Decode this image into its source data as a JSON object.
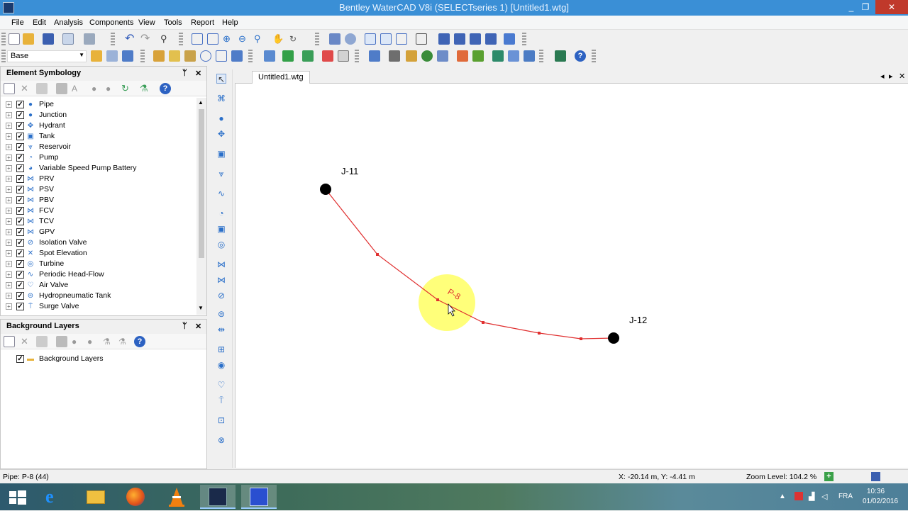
{
  "window": {
    "title": "Bentley WaterCAD V8i (SELECTseries 1) [Untitled1.wtg]",
    "minimize": "_",
    "restore": "❐",
    "close": "✕"
  },
  "menu": {
    "items": [
      "File",
      "Edit",
      "Analysis",
      "Components",
      "View",
      "Tools",
      "Report",
      "Help"
    ]
  },
  "toolbar": {
    "scenario": "Base"
  },
  "element_symbology": {
    "title": "Element Symbology",
    "pin": "ᛘ",
    "close": "✕",
    "items": [
      {
        "label": "Pipe",
        "icon": "pipe-icon",
        "glyph": "●"
      },
      {
        "label": "Junction",
        "icon": "junction-icon",
        "glyph": "●"
      },
      {
        "label": "Hydrant",
        "icon": "hydrant-icon",
        "glyph": "✥"
      },
      {
        "label": "Tank",
        "icon": "tank-icon",
        "glyph": "▣"
      },
      {
        "label": "Reservoir",
        "icon": "reservoir-icon",
        "glyph": "⩔"
      },
      {
        "label": "Pump",
        "icon": "pump-icon",
        "glyph": "◔"
      },
      {
        "label": "Variable Speed Pump Battery",
        "icon": "vspb-icon",
        "glyph": "◕"
      },
      {
        "label": "PRV",
        "icon": "prv-icon",
        "glyph": "⋈"
      },
      {
        "label": "PSV",
        "icon": "psv-icon",
        "glyph": "⋈"
      },
      {
        "label": "PBV",
        "icon": "pbv-icon",
        "glyph": "⋈"
      },
      {
        "label": "FCV",
        "icon": "fcv-icon",
        "glyph": "⋈"
      },
      {
        "label": "TCV",
        "icon": "tcv-icon",
        "glyph": "⋈"
      },
      {
        "label": "GPV",
        "icon": "gpv-icon",
        "glyph": "⋈"
      },
      {
        "label": "Isolation Valve",
        "icon": "isolation-valve-icon",
        "glyph": "⊘"
      },
      {
        "label": "Spot Elevation",
        "icon": "spot-elevation-icon",
        "glyph": "✕"
      },
      {
        "label": "Turbine",
        "icon": "turbine-icon",
        "glyph": "◎"
      },
      {
        "label": "Periodic Head-Flow",
        "icon": "periodic-head-flow-icon",
        "glyph": "∿"
      },
      {
        "label": "Air Valve",
        "icon": "air-valve-icon",
        "glyph": "♡"
      },
      {
        "label": "Hydropneumatic Tank",
        "icon": "hydropneumatic-tank-icon",
        "glyph": "⊜"
      },
      {
        "label": "Surge Valve",
        "icon": "surge-valve-icon",
        "glyph": "⍑"
      }
    ]
  },
  "background_layers": {
    "title": "Background Layers",
    "pin": "ᛘ",
    "close": "✕",
    "items": [
      {
        "label": "Background Layers"
      }
    ]
  },
  "document": {
    "tab": "Untitled1.wtg",
    "nav_prev": "◂",
    "nav_next": "▸",
    "close": "✕"
  },
  "network": {
    "nodes": [
      {
        "id": "J-11"
      },
      {
        "id": "J-12"
      }
    ],
    "pipe": {
      "id": "P-8"
    }
  },
  "status": {
    "selection": "Pipe: P-8 (44)",
    "coordinates": "X: -20.14 m, Y: -4.41 m",
    "zoom": "Zoom Level: 104.2 %"
  },
  "taskbar": {
    "language": "FRA",
    "time": "10:36",
    "date": "01/02/2016",
    "apps": [
      "start-button",
      "internet-explorer-icon",
      "file-explorer-icon",
      "firefox-icon",
      "vlc-icon",
      "watercad-taskbar-icon",
      "bentley-taskbar-icon"
    ]
  }
}
